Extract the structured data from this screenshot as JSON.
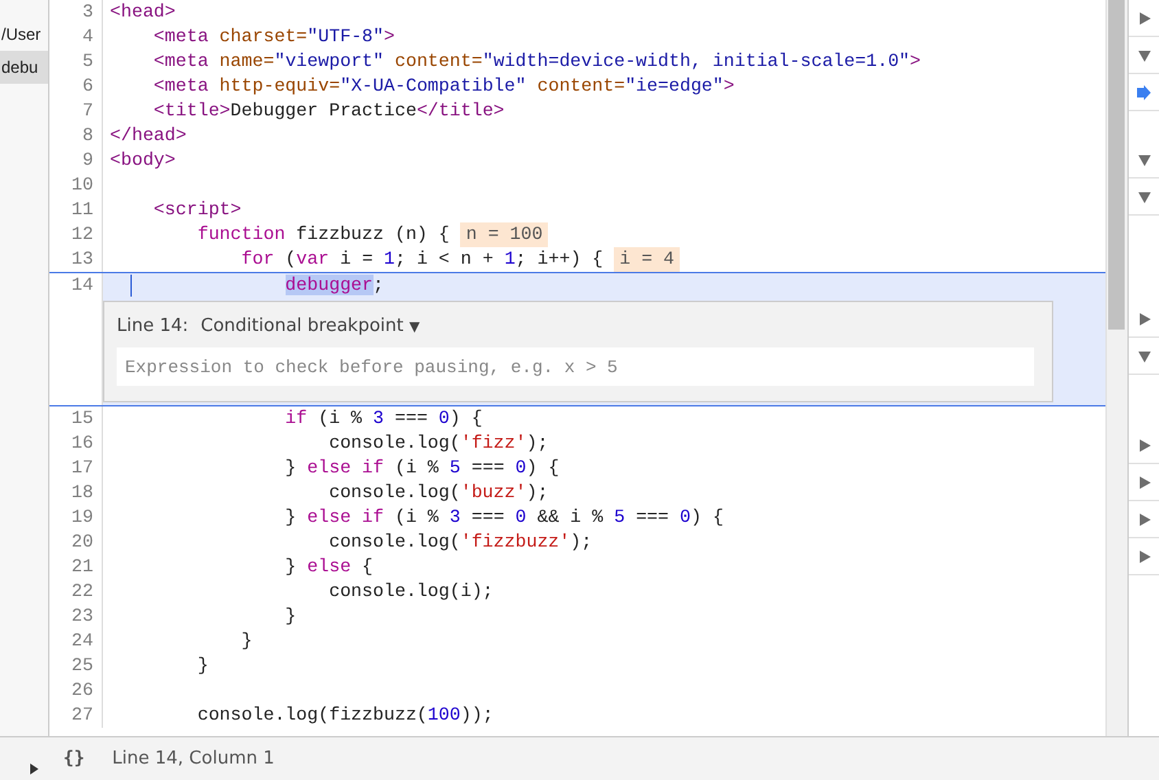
{
  "sidebar": {
    "items": [
      {
        "label": "/User",
        "selected": false
      },
      {
        "label": "debu",
        "selected": true
      }
    ]
  },
  "code": {
    "lines_before": [
      {
        "number": "3",
        "current": false,
        "tokens": [
          {
            "t": "<head>",
            "kind": "tag"
          }
        ]
      },
      {
        "number": "4",
        "current": false,
        "tokens": [
          {
            "t": "    <meta",
            "kind": "tag"
          },
          {
            "t": " charset=",
            "kind": "attr"
          },
          {
            "t": "\"UTF-8\"",
            "kind": "val"
          },
          {
            "t": ">",
            "kind": "tag"
          }
        ]
      },
      {
        "number": "5",
        "current": false,
        "tokens": [
          {
            "t": "    <meta",
            "kind": "tag"
          },
          {
            "t": " name=",
            "kind": "attr"
          },
          {
            "t": "\"viewport\"",
            "kind": "val"
          },
          {
            "t": " content=",
            "kind": "attr"
          },
          {
            "t": "\"width=device-width, initial-scale=1.0\"",
            "kind": "val"
          },
          {
            "t": ">",
            "kind": "tag"
          }
        ]
      },
      {
        "number": "6",
        "current": false,
        "tokens": [
          {
            "t": "    <meta",
            "kind": "tag"
          },
          {
            "t": " http-equiv=",
            "kind": "attr"
          },
          {
            "t": "\"X-UA-Compatible\"",
            "kind": "val"
          },
          {
            "t": " content=",
            "kind": "attr"
          },
          {
            "t": "\"ie=edge\"",
            "kind": "val"
          },
          {
            "t": ">",
            "kind": "tag"
          }
        ]
      },
      {
        "number": "7",
        "current": false,
        "tokens": [
          {
            "t": "    <title>",
            "kind": "tag"
          },
          {
            "t": "Debugger Practice",
            "kind": "plain"
          },
          {
            "t": "</title>",
            "kind": "tag"
          }
        ]
      },
      {
        "number": "8",
        "current": false,
        "tokens": [
          {
            "t": "</head>",
            "kind": "tag"
          }
        ]
      },
      {
        "number": "9",
        "current": false,
        "tokens": [
          {
            "t": "<body>",
            "kind": "tag"
          }
        ]
      },
      {
        "number": "10",
        "current": false
      },
      {
        "number": "11",
        "current": false,
        "tokens": [
          {
            "t": "    <script>",
            "kind": "tag"
          }
        ]
      },
      {
        "number": "12",
        "current": false,
        "inline_value": "n = 100",
        "tokens": [
          {
            "t": "        function",
            "kind": "kw"
          },
          {
            "t": " fizzbuzz (n) {",
            "kind": "plain"
          }
        ]
      },
      {
        "number": "13",
        "current": false,
        "inline_value": "i = 4",
        "tokens": [
          {
            "t": "            for",
            "kind": "kw"
          },
          {
            "t": " (",
            "kind": "plain"
          },
          {
            "t": "var",
            "kind": "kw"
          },
          {
            "t": " i = ",
            "kind": "plain"
          },
          {
            "t": "1",
            "kind": "num"
          },
          {
            "t": "; i < n + ",
            "kind": "plain"
          },
          {
            "t": "1",
            "kind": "num"
          },
          {
            "t": "; i++) {",
            "kind": "plain"
          }
        ]
      },
      {
        "number": "14",
        "current": true,
        "tokens": [
          {
            "t": "                debugger",
            "kind": "match"
          },
          {
            "t": ";",
            "kind": "plain"
          }
        ]
      }
    ],
    "breakpoint_editor": {
      "line_label": "Line 14:",
      "type_label": "Conditional breakpoint",
      "caret": "▼",
      "placeholder": "Expression to check before pausing, e.g. x > 5"
    },
    "lines_after": [
      {
        "number": "15",
        "current": false,
        "tokens": [
          {
            "t": "                if",
            "kind": "kw"
          },
          {
            "t": " (i % ",
            "kind": "plain"
          },
          {
            "t": "3",
            "kind": "num"
          },
          {
            "t": " === ",
            "kind": "plain"
          },
          {
            "t": "0",
            "kind": "num"
          },
          {
            "t": ") {",
            "kind": "plain"
          }
        ]
      },
      {
        "number": "16",
        "current": false,
        "tokens": [
          {
            "t": "                    console.log(",
            "kind": "plain"
          },
          {
            "t": "'fizz'",
            "kind": "str"
          },
          {
            "t": ");",
            "kind": "plain"
          }
        ]
      },
      {
        "number": "17",
        "current": false,
        "tokens": [
          {
            "t": "                } ",
            "kind": "plain"
          },
          {
            "t": "else if",
            "kind": "kw"
          },
          {
            "t": " (i % ",
            "kind": "plain"
          },
          {
            "t": "5",
            "kind": "num"
          },
          {
            "t": " === ",
            "kind": "plain"
          },
          {
            "t": "0",
            "kind": "num"
          },
          {
            "t": ") {",
            "kind": "plain"
          }
        ]
      },
      {
        "number": "18",
        "current": false,
        "tokens": [
          {
            "t": "                    console.log(",
            "kind": "plain"
          },
          {
            "t": "'buzz'",
            "kind": "str"
          },
          {
            "t": ");",
            "kind": "plain"
          }
        ]
      },
      {
        "number": "19",
        "current": false,
        "tokens": [
          {
            "t": "                } ",
            "kind": "plain"
          },
          {
            "t": "else if",
            "kind": "kw"
          },
          {
            "t": " (i % ",
            "kind": "plain"
          },
          {
            "t": "3",
            "kind": "num"
          },
          {
            "t": " === ",
            "kind": "plain"
          },
          {
            "t": "0",
            "kind": "num"
          },
          {
            "t": " && i % ",
            "kind": "plain"
          },
          {
            "t": "5",
            "kind": "num"
          },
          {
            "t": " === ",
            "kind": "plain"
          },
          {
            "t": "0",
            "kind": "num"
          },
          {
            "t": ") {",
            "kind": "plain"
          }
        ]
      },
      {
        "number": "20",
        "current": false,
        "tokens": [
          {
            "t": "                    console.log(",
            "kind": "plain"
          },
          {
            "t": "'fizzbuzz'",
            "kind": "str"
          },
          {
            "t": ");",
            "kind": "plain"
          }
        ]
      },
      {
        "number": "21",
        "current": false,
        "tokens": [
          {
            "t": "                } ",
            "kind": "plain"
          },
          {
            "t": "else",
            "kind": "kw"
          },
          {
            "t": " {",
            "kind": "plain"
          }
        ]
      },
      {
        "number": "22",
        "current": false,
        "tokens": [
          {
            "t": "                    console.log(i);",
            "kind": "plain"
          }
        ]
      },
      {
        "number": "23",
        "current": false,
        "tokens": [
          {
            "t": "                }",
            "kind": "plain"
          }
        ]
      },
      {
        "number": "24",
        "current": false,
        "tokens": [
          {
            "t": "            }",
            "kind": "plain"
          }
        ]
      },
      {
        "number": "25",
        "current": false,
        "tokens": [
          {
            "t": "        }",
            "kind": "plain"
          }
        ]
      },
      {
        "number": "26",
        "current": false
      },
      {
        "number": "27",
        "current": false,
        "tokens": [
          {
            "t": "        console.log(fizzbuzz(",
            "kind": "plain"
          },
          {
            "t": "100",
            "kind": "num"
          },
          {
            "t": "));",
            "kind": "plain"
          }
        ]
      }
    ]
  },
  "right_panel": {
    "sections": [
      {
        "kind": "toggle",
        "expanded": false
      },
      {
        "kind": "toggle",
        "expanded": true
      },
      {
        "kind": "pointer",
        "expanded": false
      },
      {
        "kind": "toggle",
        "expanded": true
      },
      {
        "kind": "toggle",
        "expanded": true
      },
      {
        "kind": "toggle",
        "expanded": false
      },
      {
        "kind": "toggle",
        "expanded": true
      },
      {
        "kind": "toggle",
        "expanded": false
      },
      {
        "kind": "toggle",
        "expanded": false
      },
      {
        "kind": "toggle",
        "expanded": false
      },
      {
        "kind": "toggle",
        "expanded": false
      }
    ]
  },
  "status_bar": {
    "format_icon": "{}",
    "position": "Line 14, Column 1"
  }
}
